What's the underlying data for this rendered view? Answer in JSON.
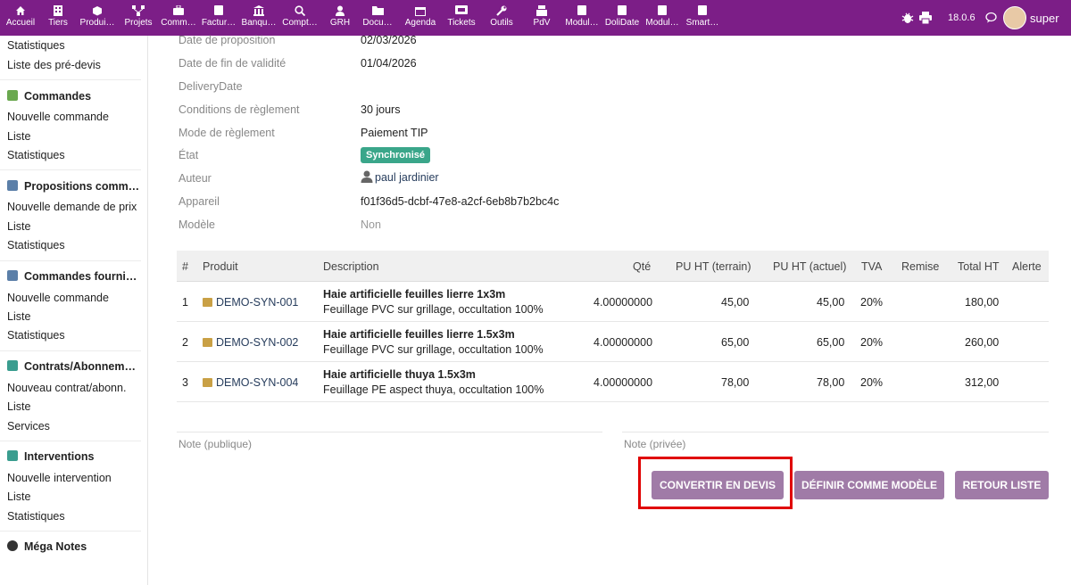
{
  "topbar": {
    "menu": [
      {
        "label": "Accueil",
        "icon": "home-icon"
      },
      {
        "label": "Tiers",
        "icon": "building-icon"
      },
      {
        "label": "Produi…",
        "icon": "cube-icon"
      },
      {
        "label": "Projets",
        "icon": "sitemap-icon"
      },
      {
        "label": "Comm…",
        "icon": "briefcase-icon"
      },
      {
        "label": "Factur…",
        "icon": "invoice-icon"
      },
      {
        "label": "Banqu…",
        "icon": "bank-icon"
      },
      {
        "label": "Compt…",
        "icon": "search-icon"
      },
      {
        "label": "GRH",
        "icon": "user-icon"
      },
      {
        "label": "Docu…",
        "icon": "folder-icon"
      },
      {
        "label": "Agenda",
        "icon": "calendar-icon"
      },
      {
        "label": "Tickets",
        "icon": "ticket-icon"
      },
      {
        "label": "Outils",
        "icon": "wrench-icon"
      },
      {
        "label": "PdV",
        "icon": "cash-register-icon"
      },
      {
        "label": "Modul…",
        "icon": "module-icon"
      },
      {
        "label": "DoliDate",
        "icon": "module-icon"
      },
      {
        "label": "Modul…",
        "icon": "module-icon"
      },
      {
        "label": "Smart…",
        "icon": "module-icon"
      }
    ],
    "version": "18.0.6",
    "user": "super",
    "bg_color": "#7c1e87"
  },
  "sidebar": {
    "items": [
      "Statistiques",
      "Liste des pré-devis",
      "Commandes",
      "Nouvelle commande",
      "Liste",
      "Statistiques",
      "Propositions comm…",
      "Nouvelle demande de prix",
      "Liste",
      "Statistiques",
      "Commandes fournis…",
      "Nouvelle commande",
      "Liste",
      "Statistiques",
      "Contrats/Abonneme…",
      "Nouveau contrat/abonn.",
      "Liste",
      "Services",
      "Interventions",
      "Nouvelle intervention",
      "Liste",
      "Statistiques",
      "Méga Notes"
    ]
  },
  "fields": {
    "labels": [
      "Date de proposition",
      "Date de fin de validité",
      "DeliveryDate",
      "Conditions de règlement",
      "Mode de règlement",
      "État",
      "Auteur",
      "Appareil",
      "Modèle"
    ],
    "date_proposal": "02/03/2026",
    "date_end": "01/04/2026",
    "payment_terms": "30 jours",
    "payment_mode": "Paiement TIP",
    "status": "Synchronisé",
    "status_color": "#3aa68a",
    "author": "paul jardinier",
    "device": "f01f36d5-dcbf-47e8-a2cf-6eb8b7b2bc4c",
    "template": "Non"
  },
  "table": {
    "headers": [
      "#",
      "Produit",
      "Description",
      "Qté",
      "PU HT (terrain)",
      "PU HT (actuel)",
      "TVA",
      "Remise",
      "Total HT",
      "Alerte"
    ],
    "rows": [
      {
        "num": "1",
        "ref": "DEMO-SYN-001",
        "title": "Haie artificielle feuilles lierre 1x3m",
        "desc": "Feuillage PVC sur grillage, occultation 100%",
        "qty": "4.00000000",
        "pu_terrain": "45,00",
        "pu_actuel": "45,00",
        "tva": "20%",
        "total": "180,00"
      },
      {
        "num": "2",
        "ref": "DEMO-SYN-002",
        "title": "Haie artificielle feuilles lierre 1.5x3m",
        "desc": "Feuillage PVC sur grillage, occultation 100%",
        "qty": "4.00000000",
        "pu_terrain": "65,00",
        "pu_actuel": "65,00",
        "tva": "20%",
        "total": "260,00"
      },
      {
        "num": "3",
        "ref": "DEMO-SYN-004",
        "title": "Haie artificielle thuya 1.5x3m",
        "desc": "Feuillage PE aspect thuya, occultation 100%",
        "qty": "4.00000000",
        "pu_terrain": "78,00",
        "pu_actuel": "78,00",
        "tva": "20%",
        "total": "312,00"
      }
    ]
  },
  "notes": {
    "public": "Note (publique)",
    "private": "Note (privée)"
  },
  "buttons": {
    "convert": "CONVERTIR EN DEVIS",
    "set_template": "DÉFINIR COMME MODÈLE",
    "back": "RETOUR LISTE",
    "color": "#a07ba7",
    "highlight_color": "#e00000"
  }
}
